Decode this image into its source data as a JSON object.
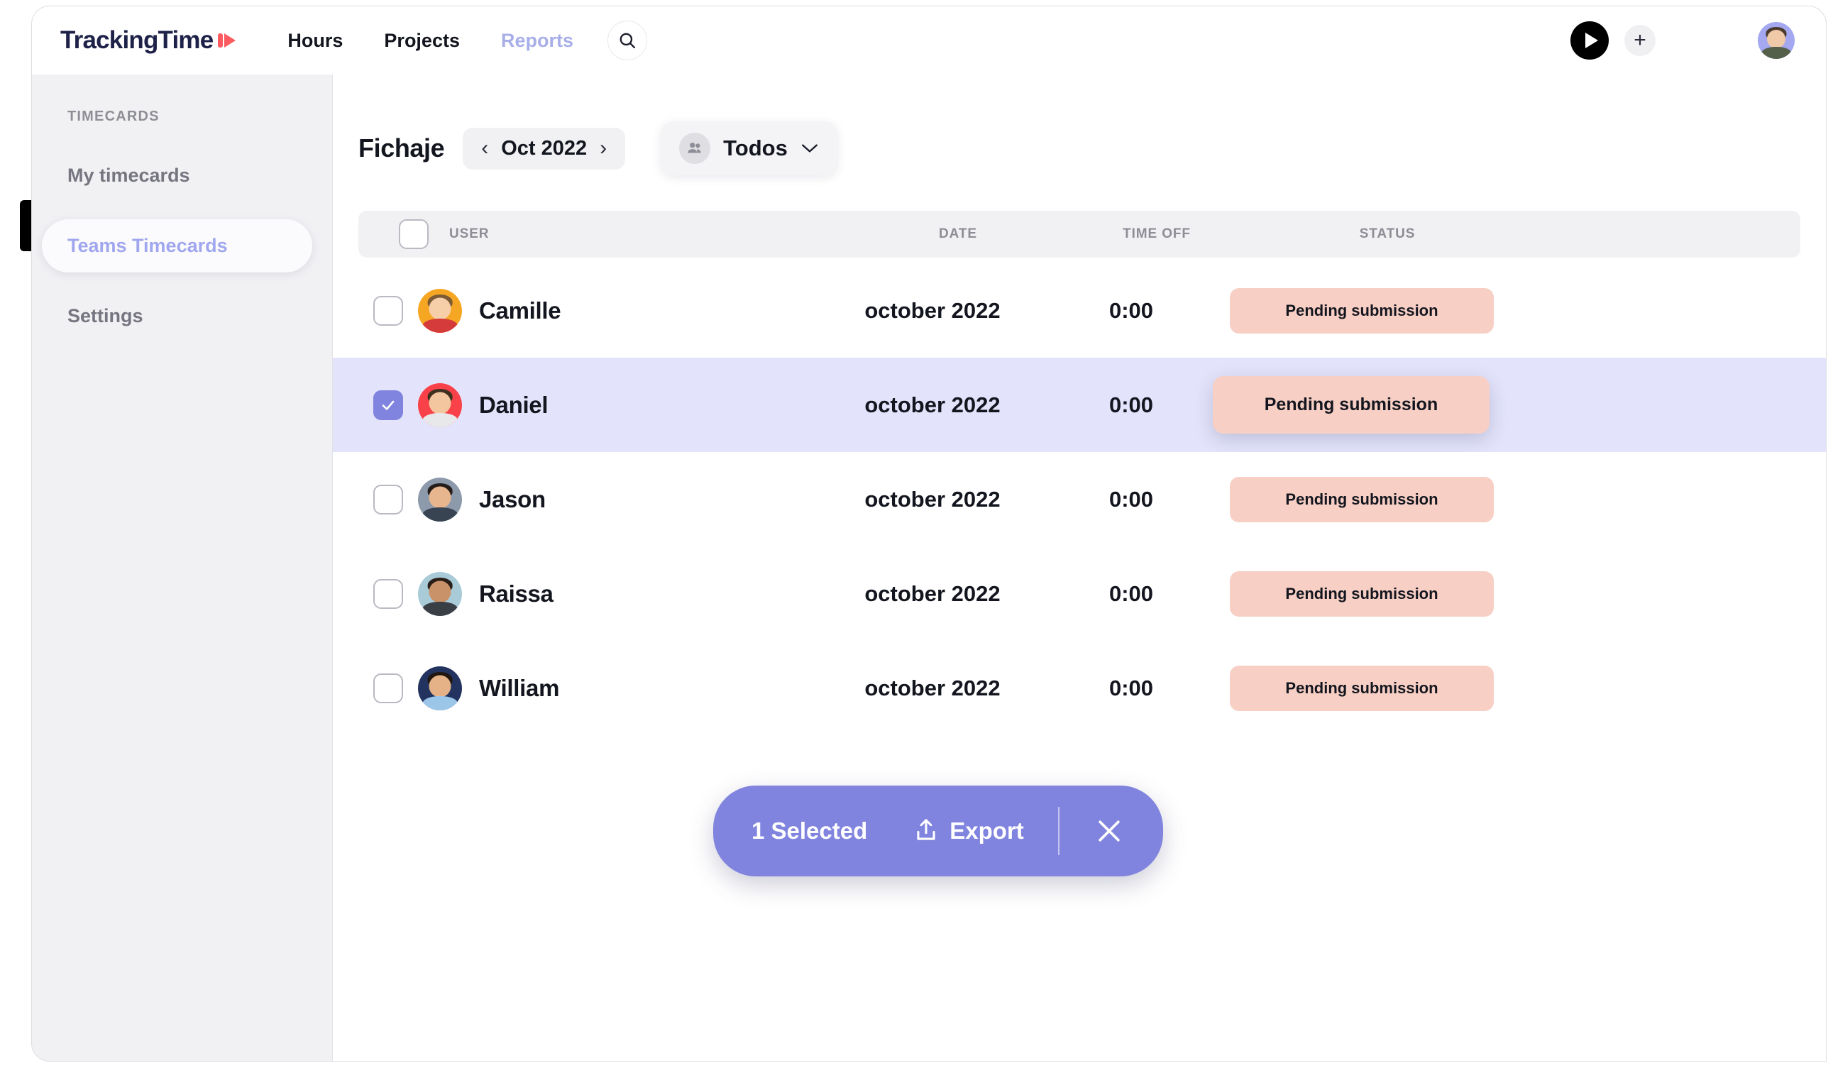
{
  "app": {
    "logo_text": "TrackingTime",
    "logo_icon": "play-logo-mark"
  },
  "topnav": {
    "items": [
      {
        "label": "Hours",
        "active": false
      },
      {
        "label": "Projects",
        "active": false
      },
      {
        "label": "Reports",
        "active": true
      }
    ],
    "search_icon": "search-icon",
    "play_icon": "play-icon",
    "add_icon": "plus-icon",
    "avatar_icon": "user-avatar"
  },
  "sidebar": {
    "heading": "TIMECARDS",
    "items": [
      {
        "label": "My timecards",
        "active": false
      },
      {
        "label": "Teams Timecards",
        "active": true
      },
      {
        "label": "Settings",
        "active": false
      }
    ]
  },
  "page": {
    "title": "Fichaje",
    "month": "Oct 2022",
    "prev_icon": "chevron-left-icon",
    "next_icon": "chevron-right-icon",
    "filter_label": "Todos",
    "filter_icon": "group-users-icon",
    "filter_caret": "chevron-down-icon"
  },
  "table": {
    "columns": [
      "USER",
      "DATE",
      "TIME OFF",
      "STATUS"
    ],
    "rows": [
      {
        "user": "Camille",
        "date": "october 2022",
        "time_off": "0:00",
        "status": "Pending submission",
        "selected": false,
        "avatar_bg": "#f5a623"
      },
      {
        "user": "Daniel",
        "date": "october 2022",
        "time_off": "0:00",
        "status": "Pending submission",
        "selected": true,
        "avatar_bg": "#f9414a"
      },
      {
        "user": "Jason",
        "date": "october 2022",
        "time_off": "0:00",
        "status": "Pending submission",
        "selected": false,
        "avatar_bg": "#8d9aab"
      },
      {
        "user": "Raissa",
        "date": "october 2022",
        "time_off": "0:00",
        "status": "Pending submission",
        "selected": false,
        "avatar_bg": "#a9cbd8"
      },
      {
        "user": "William",
        "date": "october 2022",
        "time_off": "0:00",
        "status": "Pending submission",
        "selected": false,
        "avatar_bg": "#23335f"
      }
    ]
  },
  "action_bar": {
    "count_label": "1 Selected",
    "export_label": "Export",
    "export_icon": "upload-icon",
    "close_icon": "close-icon"
  },
  "colors": {
    "accent_purple": "#8084de",
    "accent_lavender": "#a0a7ee",
    "selected_row": "#e3e4fb",
    "badge_pink": "#f7cfc4",
    "brand_red": "#ff5a5f",
    "sidebar_bg": "#f1f1f4"
  }
}
